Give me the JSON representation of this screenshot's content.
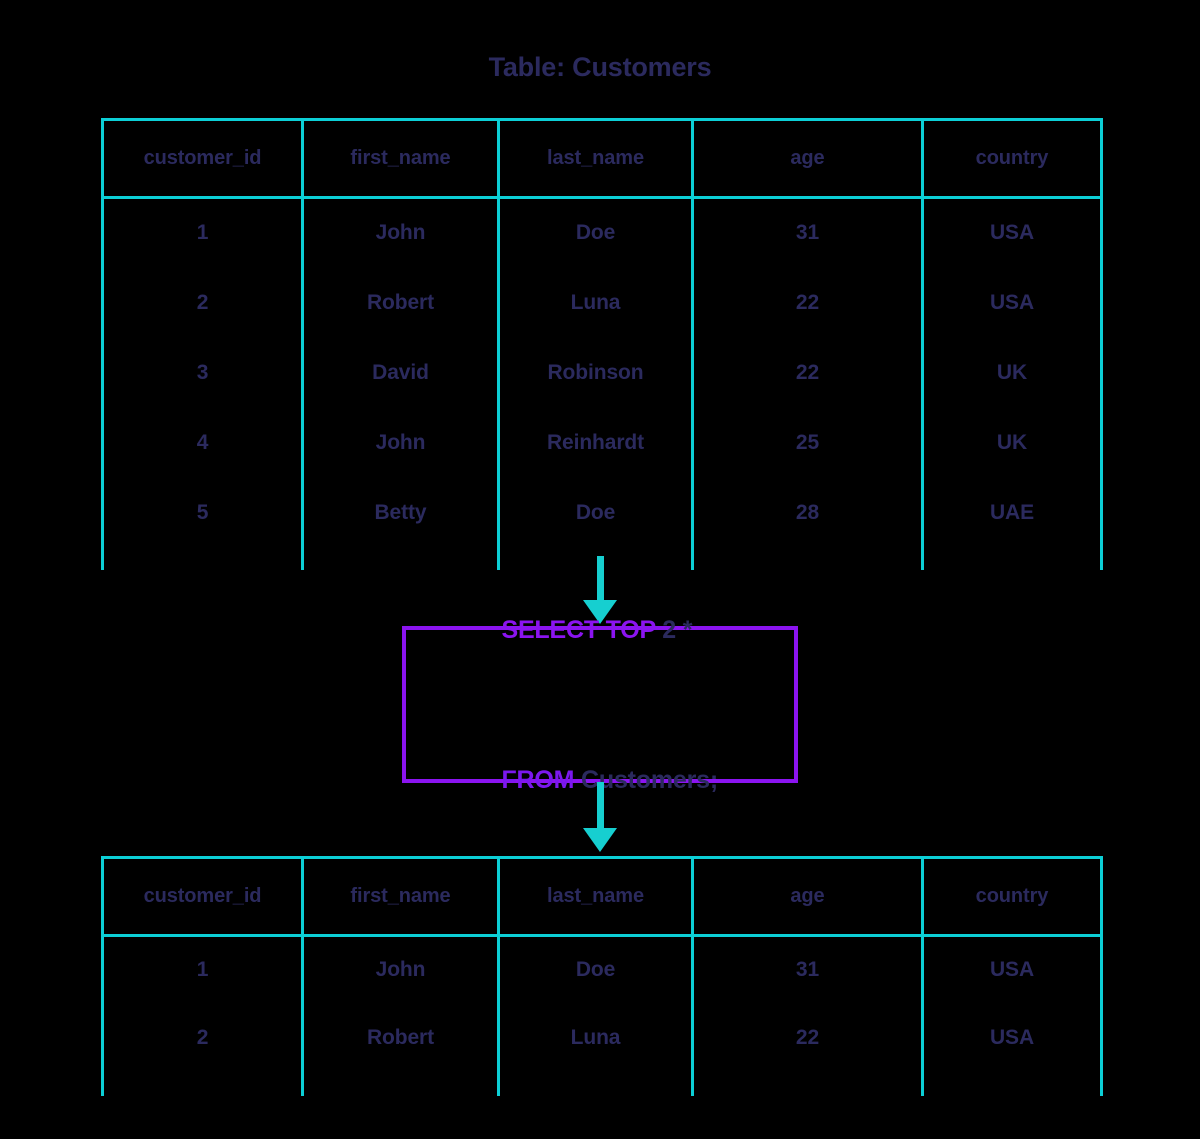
{
  "title": "Table: Customers",
  "colors": {
    "table_border": "#0ccfd6",
    "text_navy": "#2b2a5e",
    "query_border": "#8b14f0",
    "keyword_purple": "#8b14f0",
    "arrow": "#16cfd0",
    "background": "#000000"
  },
  "source_table": {
    "name": "Customers",
    "columns": [
      "customer_id",
      "first_name",
      "last_name",
      "age",
      "country"
    ],
    "rows": [
      {
        "customer_id": "1",
        "first_name": "John",
        "last_name": "Doe",
        "age": "31",
        "country": "USA"
      },
      {
        "customer_id": "2",
        "first_name": "Robert",
        "last_name": "Luna",
        "age": "22",
        "country": "USA"
      },
      {
        "customer_id": "3",
        "first_name": "David",
        "last_name": "Robinson",
        "age": "22",
        "country": "UK"
      },
      {
        "customer_id": "4",
        "first_name": "John",
        "last_name": "Reinhardt",
        "age": "25",
        "country": "UK"
      },
      {
        "customer_id": "5",
        "first_name": "Betty",
        "last_name": "Doe",
        "age": "28",
        "country": "UAE"
      }
    ]
  },
  "query": {
    "line1_keyword": "SELECT TOP",
    "line1_rest": " 2 *",
    "line2_keyword": "FROM",
    "line2_rest": " Customers;",
    "full_text": "SELECT TOP 2 * FROM Customers;"
  },
  "result_table": {
    "columns": [
      "customer_id",
      "first_name",
      "last_name",
      "age",
      "country"
    ],
    "rows": [
      {
        "customer_id": "1",
        "first_name": "John",
        "last_name": "Doe",
        "age": "31",
        "country": "USA"
      },
      {
        "customer_id": "2",
        "first_name": "Robert",
        "last_name": "Luna",
        "age": "22",
        "country": "USA"
      }
    ]
  },
  "arrows": {
    "first_label": "down-arrow-to-query",
    "second_label": "down-arrow-to-result"
  }
}
